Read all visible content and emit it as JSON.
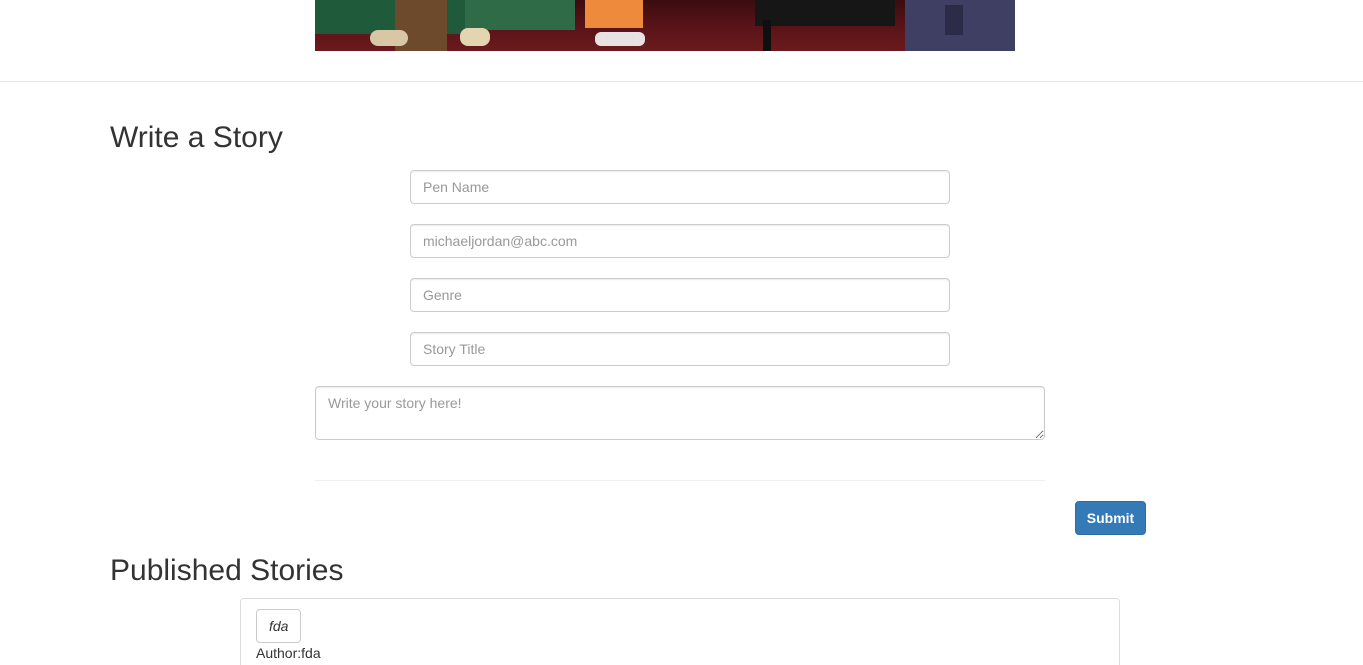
{
  "form": {
    "heading": "Write a Story",
    "pen_name_placeholder": "Pen Name",
    "email_placeholder": "michaeljordan@abc.com",
    "genre_placeholder": "Genre",
    "story_title_placeholder": "Story Title",
    "story_body_placeholder": "Write your story here!",
    "submit_label": "Submit"
  },
  "published": {
    "heading": "Published Stories",
    "stories": [
      {
        "title": "fda",
        "author_label": "Author:",
        "author": "fda"
      }
    ]
  },
  "colors": {
    "primary": "#337ab7",
    "heading": "#333333",
    "border": "#cccccc"
  }
}
